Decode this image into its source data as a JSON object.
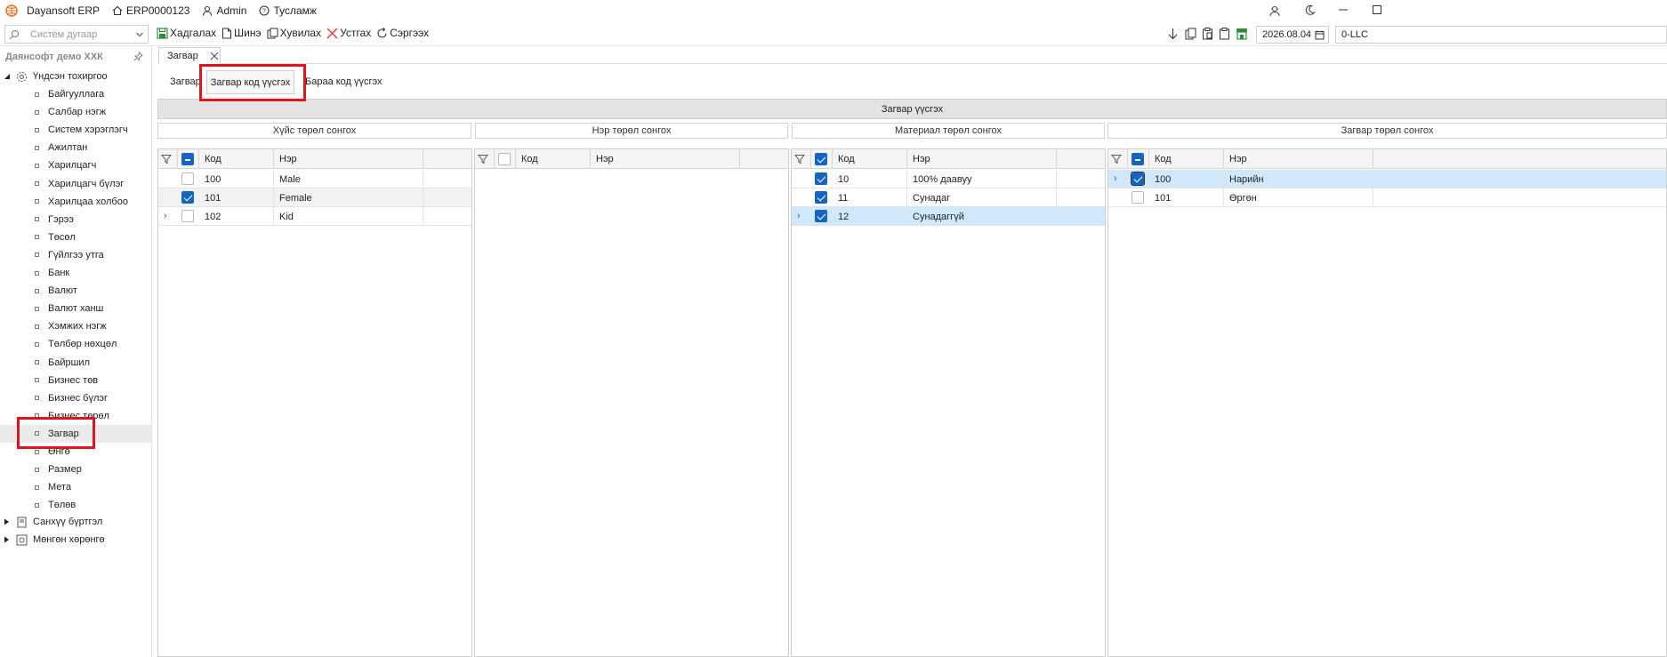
{
  "titlebar": {
    "app": "Dayansoft ERP",
    "code": "ERP0000123",
    "user": "Admin",
    "help": "Тусламж"
  },
  "toolbar": {
    "search_placeholder": "Систем дугаар",
    "save": "Хадгалах",
    "new": "Шинэ",
    "copy": "Хувилах",
    "delete": "Устгах",
    "refresh": "Сэргээх",
    "date": "2026.08.04",
    "company": "0-LLC"
  },
  "sidebar": {
    "company": "Даянсофт демо ХХК",
    "root": "Үндсэн тохиргоо",
    "items": [
      "Байгууллага",
      "Салбар нэгж",
      "Систем хэрэглэгч",
      "Ажилтан",
      "Харилцагч",
      "Харилцагч бүлэг",
      "Харилцаа холбоо",
      "Гэрээ",
      "Төсөл",
      "Гүйлгээ утга",
      "Банк",
      "Валют",
      "Валют ханш",
      "Хэмжих нэгж",
      "Төлбөр нөхцөл",
      "Байршил",
      "Бизнес төв",
      "Бизнес бүлэг",
      "Бизнес төрөл",
      "Загвар",
      "Өнгө",
      "Размер",
      "Мета",
      "Төлөв"
    ],
    "group2": "Санхүү бүртгэл",
    "group3": "Мөнгөн хөрөнгө"
  },
  "main": {
    "tab": "Загвар",
    "subtabs": [
      "Загвар",
      "Загвар код үүсгэх",
      "Бараа код үүсгэх"
    ],
    "banner": "Загвар үүсгэх",
    "sections": [
      "Хүйс төрөл сонгох",
      "Нэр төрөл сонгох",
      "Материал төрөл сонгох",
      "Загвар төрөл сонгох"
    ],
    "col_code": "Код",
    "col_name": "Нэр",
    "grid1": [
      {
        "code": "100",
        "name": "Male",
        "checked": false
      },
      {
        "code": "101",
        "name": "Female",
        "checked": true
      },
      {
        "code": "102",
        "name": "Kid",
        "checked": false
      }
    ],
    "grid3": [
      {
        "code": "10",
        "name": "100% даавуу",
        "checked": true
      },
      {
        "code": "11",
        "name": "Сунадаг",
        "checked": true
      },
      {
        "code": "12",
        "name": "Сунадаггүй",
        "checked": true
      }
    ],
    "grid4": [
      {
        "code": "100",
        "name": "Нарийн",
        "checked": true
      },
      {
        "code": "101",
        "name": "Өргөн",
        "checked": false
      }
    ]
  }
}
